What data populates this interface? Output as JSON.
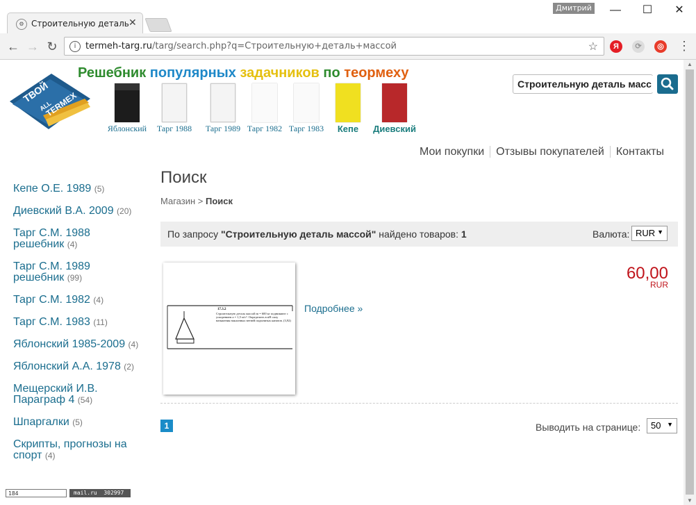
{
  "browser": {
    "tab_title": "Строительную деталь м",
    "user": "Дмитрий",
    "url_host": "termeh-targ.ru",
    "url_path": "/targ/search.php?q=Строительную+деталь+массой",
    "ext_label": "Я"
  },
  "site": {
    "title_parts": [
      "Решебник",
      "популярных",
      "задачников",
      "по",
      "теормеху"
    ],
    "logo_text": [
      "ТВОЙ",
      "ALL",
      "TERMEX"
    ],
    "books": [
      {
        "label": "Яблонский"
      },
      {
        "label": "Тарг 1988"
      },
      {
        "label": "Тарг 1989"
      },
      {
        "label": "Тарг 1982"
      },
      {
        "label": "Тарг 1983"
      },
      {
        "label": "Кепе"
      },
      {
        "label": "Диевский"
      }
    ],
    "search_value": "Строительную деталь масс",
    "nav": [
      "Мои покупки",
      "Отзывы покупателей",
      "Контакты"
    ]
  },
  "sidebar": {
    "items": [
      {
        "label": "Кепе О.Е. 1989",
        "count": "(5)"
      },
      {
        "label": "Диевский В.А. 2009",
        "count": "(20)"
      },
      {
        "label": "Тарг С.М. 1988 решебник",
        "count": "(4)"
      },
      {
        "label": "Тарг С.М. 1989 решебник",
        "count": "(99)"
      },
      {
        "label": "Тарг С.М. 1982",
        "count": "(4)"
      },
      {
        "label": "Тарг С.М. 1983",
        "count": "(11)"
      },
      {
        "label": "Яблонский 1985-2009",
        "count": "(4)"
      },
      {
        "label": "Яблонский А.А. 1978",
        "count": "(2)"
      },
      {
        "label": "Мещерский И.В. Параграф 4",
        "count": "(54)"
      },
      {
        "label": "Шпаргалки",
        "count": "(5)"
      },
      {
        "label": "Скрипты, прогнозы на спорт",
        "count": "(4)"
      }
    ]
  },
  "main": {
    "heading": "Поиск",
    "breadcrumb_shop": "Магазин",
    "breadcrumb_sep": ">",
    "breadcrumb_current": "Поиск",
    "result_prefix": "По запросу",
    "result_query": "\"Строительную деталь массой\"",
    "result_mid": "найдено товаров:",
    "result_count": "1",
    "currency_label": "Валюта:",
    "currency_value": "RUR",
    "product": {
      "more": "Подробнее »",
      "price": "60,00",
      "price_currency": "RUR",
      "thumb_number": "17.3.2",
      "thumb_text": "Строительную деталь массой m = 600 кг поднимают с ускорением a = 1,5 м/с². Определить в кН силу натяжения наклонных ветвей подъемных канатов. (3,92)"
    },
    "page_current": "1",
    "per_page_label": "Выводить на странице:",
    "per_page_value": "50"
  },
  "footer": {
    "counter1": "184",
    "counter2_a": "mail.ru",
    "counter2_b": "302997"
  }
}
